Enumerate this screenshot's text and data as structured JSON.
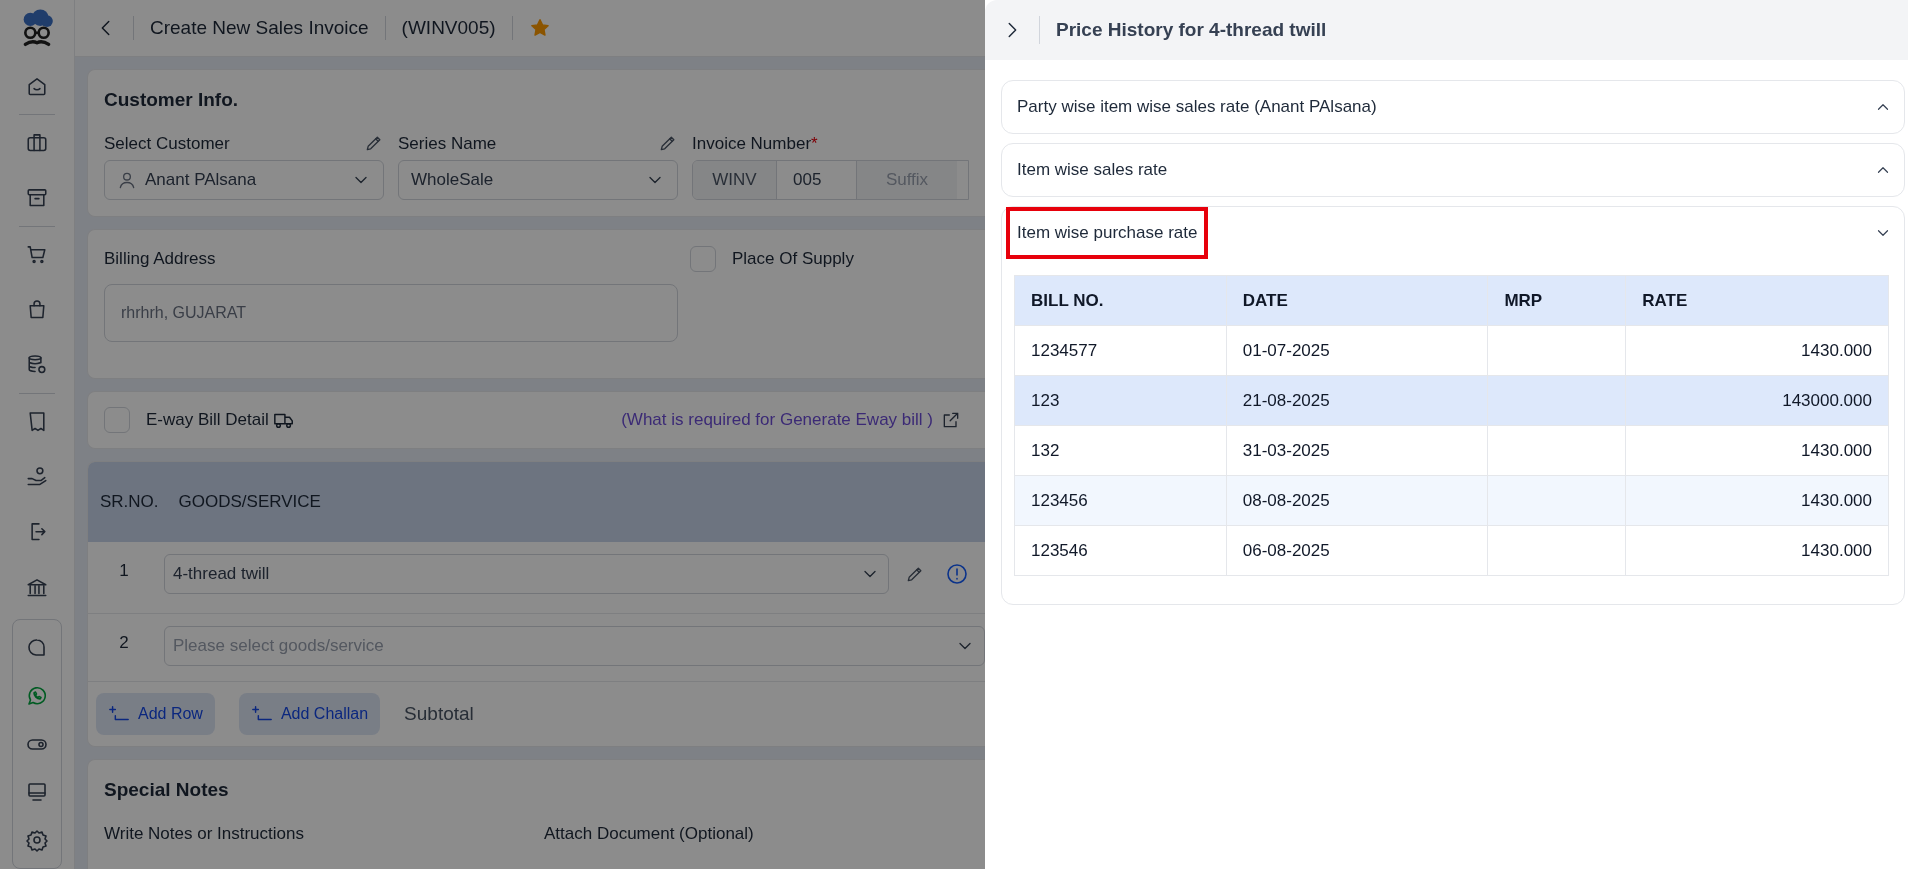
{
  "header": {
    "page_title": "Create New Sales Invoice",
    "invoice_code": "(WINV005)",
    "favorite": true
  },
  "customer_info": {
    "heading": "Customer Info.",
    "customer": {
      "label": "Select Customer",
      "value": "Anant PAlsana"
    },
    "series": {
      "label": "Series Name",
      "value": "WholeSale"
    },
    "invoice_number": {
      "label": "Invoice Number",
      "required_mark": "*",
      "prefix": "WINV",
      "number": "005",
      "suffix_placeholder": "Suffix"
    }
  },
  "billing": {
    "label": "Billing Address",
    "value": "rhrhrh, GUJARAT",
    "place_of_supply": {
      "label": "Place Of Supply",
      "checked": false
    }
  },
  "eway": {
    "label": "E-way Bill Detail",
    "checked": false,
    "link": "(What is required for Generate Eway bill )"
  },
  "items_table": {
    "columns": [
      "SR.NO.",
      "GOODS/SERVICE"
    ],
    "rows": [
      {
        "sr": "1",
        "value": "4-thread twill"
      },
      {
        "sr": "2",
        "placeholder": "Please select goods/service"
      }
    ]
  },
  "actions": [
    "Add Row",
    "Add Challan"
  ],
  "subtotal_label": "Subtotal",
  "special_notes": {
    "heading": "Special Notes",
    "notes_label": "Write Notes or Instructions",
    "attach_label": "Attach Document (Optional)"
  },
  "panel": {
    "title": "Price History for 4-thread twill",
    "sections": [
      {
        "title": "Party wise item wise sales rate (Anant PAlsana)",
        "expanded": false,
        "highlighted": false
      },
      {
        "title": "Item wise sales rate",
        "expanded": false,
        "highlighted": false
      },
      {
        "title": "Item wise purchase rate",
        "expanded": true,
        "highlighted": true,
        "table": {
          "columns": [
            "BILL NO.",
            "DATE",
            "MRP",
            "RATE"
          ],
          "rows": [
            {
              "bill_no": "1234577",
              "date": "01-07-2025",
              "rate": "1430.000",
              "selected": false
            },
            {
              "bill_no": "123",
              "date": "21-08-2025",
              "rate": "143000.000",
              "selected": true
            },
            {
              "bill_no": "132",
              "date": "31-03-2025",
              "rate": "1430.000",
              "selected": false
            },
            {
              "bill_no": "123456",
              "date": "08-08-2025",
              "rate": "1430.000",
              "selected": false
            },
            {
              "bill_no": "123546",
              "date": "06-08-2025",
              "rate": "1430.000",
              "selected": false
            }
          ]
        }
      }
    ]
  }
}
